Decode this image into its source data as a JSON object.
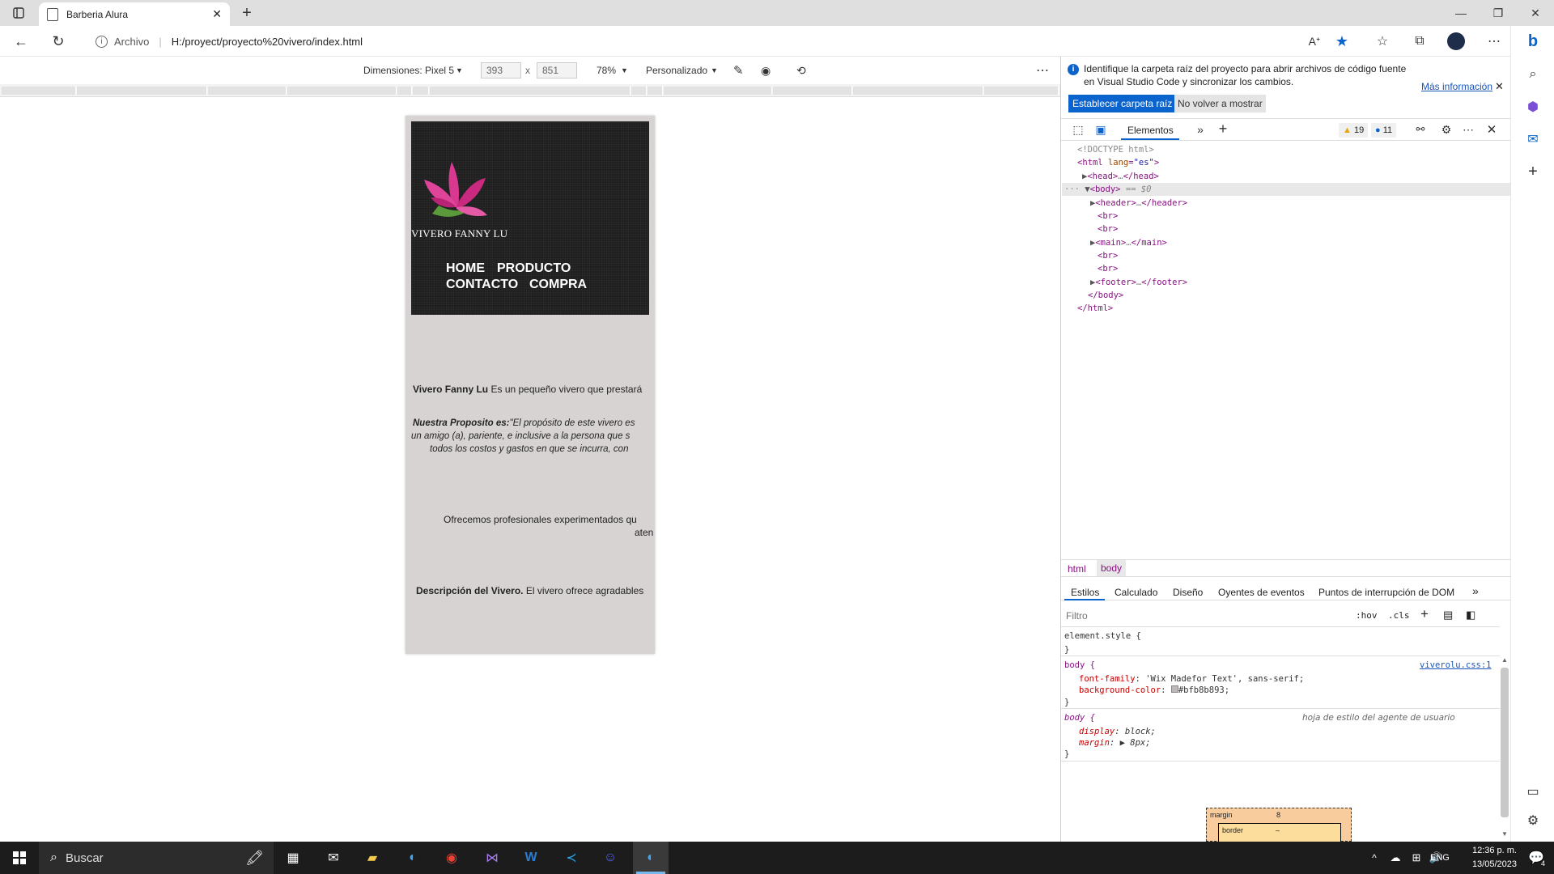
{
  "browser": {
    "tab_title": "Barberia Alura",
    "new_tab": "+",
    "address_label": "Archivo",
    "url": "H:/proyect/proyecto%20vivero/index.html"
  },
  "device_toolbar": {
    "dimensions_label": "Dimensiones: Pixel 5",
    "width": "393",
    "times": "x",
    "height": "851",
    "zoom": "78%",
    "throttle": "Personalizado"
  },
  "site": {
    "brand": "VIVERO FANNY LU",
    "nav": [
      "HOME",
      "PRODUCTO",
      "CONTACTO",
      "COMPRA"
    ],
    "p1_bold": "Vivero Fanny Lu",
    "p1_text": " Es un pequeño vivero que prestará",
    "p2_bold": "Nuestra Proposito es:",
    "p2_line1": "\"El propósito de este vivero es",
    "p2_line2": "un amigo (a), pariente, e inclusive a la persona que s",
    "p2_line3": "todos los costos y gastos en que se incurra, con",
    "p3_line1": "Ofrecemos profesionales experimentados qu",
    "p3_line2": "aten",
    "p4_bold": "Descripción del Vivero.",
    "p4_text": " El vivero ofrece agradables"
  },
  "devtools": {
    "banner_text_1": "Identifique la carpeta raíz del proyecto para abrir archivos de código fuente",
    "banner_text_2": "en Visual Studio Code y sincronizar los cambios.",
    "banner_link": "Más información",
    "btn_primary": "Establecer carpeta raíz",
    "btn_secondary": "No volver a mostrar",
    "tab_elements": "Elementos",
    "warnings": "19",
    "messages": "11",
    "dom": {
      "doctype": "<!DOCTYPE html>",
      "html_open": "<html ",
      "lang_attr": "lang",
      "lang_val": "\"es\"",
      "head": "<head>",
      "head_close": "</head>",
      "body": "<body>",
      "body_eq": " == $0",
      "header": "<header>",
      "header_close": "</header>",
      "br": "<br>",
      "main": "<main>",
      "main_close": "</main>",
      "footer": "<footer>",
      "footer_close": "</footer>",
      "body_close": "</body>",
      "html_close": "</html>",
      "ellipsis": "…"
    },
    "breadcrumb": [
      "html",
      "body"
    ],
    "panel_tabs": [
      "Estilos",
      "Calculado",
      "Diseño",
      "Oyentes de eventos",
      "Puntos de interrupción de DOM"
    ],
    "filter_placeholder": "Filtro",
    "hov": ":hov",
    "cls": ".cls",
    "styles": {
      "element_style": "element.style {",
      "close": "}",
      "body_sel": "body {",
      "source_link": "viverolu.css:1",
      "ff_prop": "font-family",
      "ff_val": "'Wix Madefor Text', sans-serif;",
      "bg_prop": "background-color",
      "bg_val": "#bfb8b893;",
      "ua_label": "hoja de estilo del agente de usuario",
      "display_prop": "display",
      "display_val": "block;",
      "margin_prop": "margin",
      "margin_val": "8px;"
    },
    "boxmodel": {
      "margin_label": "margin",
      "margin_val": "8",
      "border_label": "border",
      "border_val": "–"
    }
  },
  "taskbar": {
    "search_placeholder": "Buscar",
    "lang": "ENG",
    "time": "12:36 p. m.",
    "date": "13/05/2023",
    "notif_count": "4"
  },
  "colors": {
    "accent": "#0078d4",
    "site_bg": "#d8d3d3",
    "header_bg": "#1f1f1f",
    "flower_pink": "#e0449a"
  }
}
